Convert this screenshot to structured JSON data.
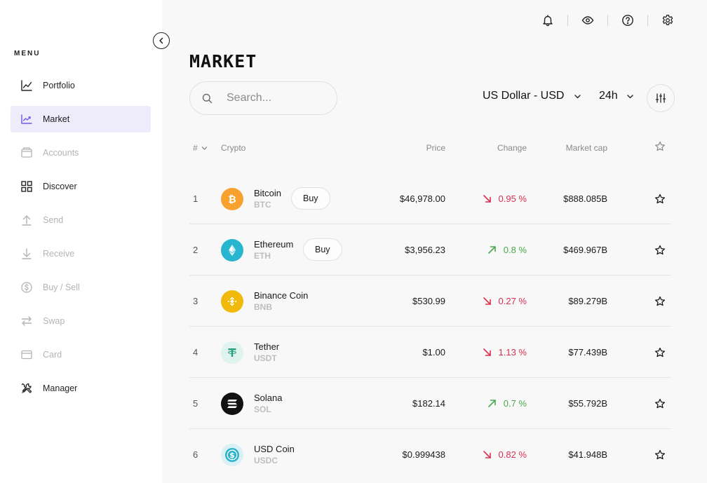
{
  "sidebar": {
    "menu_title": "MENU",
    "items": [
      {
        "label": "Portfolio",
        "icon": "chart-line-icon",
        "state": "enabled"
      },
      {
        "label": "Market",
        "icon": "trend-icon",
        "state": "active"
      },
      {
        "label": "Accounts",
        "icon": "wallet-icon",
        "state": "disabled"
      },
      {
        "label": "Discover",
        "icon": "grid-icon",
        "state": "enabled"
      },
      {
        "label": "Send",
        "icon": "arrow-up-icon",
        "state": "disabled"
      },
      {
        "label": "Receive",
        "icon": "arrow-down-icon",
        "state": "disabled"
      },
      {
        "label": "Buy / Sell",
        "icon": "dollar-circle-icon",
        "state": "disabled"
      },
      {
        "label": "Swap",
        "icon": "swap-icon",
        "state": "disabled"
      },
      {
        "label": "Card",
        "icon": "card-icon",
        "state": "disabled"
      },
      {
        "label": "Manager",
        "icon": "tools-icon",
        "state": "enabled"
      }
    ]
  },
  "topbar": {
    "icons": [
      "bell-icon",
      "eye-icon",
      "help-icon",
      "gear-icon"
    ]
  },
  "main": {
    "title": "MARKET",
    "search_placeholder": "Search...",
    "currency": "US Dollar - USD",
    "period": "24h"
  },
  "table": {
    "headers": {
      "rank": "#",
      "crypto": "Crypto",
      "price": "Price",
      "change": "Change",
      "market_cap": "Market cap"
    },
    "rows": [
      {
        "rank": "1",
        "name": "Bitcoin",
        "symbol": "BTC",
        "price": "$46,978.00",
        "change": "0.95 %",
        "direction": "down",
        "market_cap": "$888.085B",
        "buy": "Buy"
      },
      {
        "rank": "2",
        "name": "Ethereum",
        "symbol": "ETH",
        "price": "$3,956.23",
        "change": "0.8 %",
        "direction": "up",
        "market_cap": "$469.967B",
        "buy": "Buy"
      },
      {
        "rank": "3",
        "name": "Binance Coin",
        "symbol": "BNB",
        "price": "$530.99",
        "change": "0.27 %",
        "direction": "down",
        "market_cap": "$89.279B",
        "buy": ""
      },
      {
        "rank": "4",
        "name": "Tether",
        "symbol": "USDT",
        "price": "$1.00",
        "change": "1.13 %",
        "direction": "down",
        "market_cap": "$77.439B",
        "buy": ""
      },
      {
        "rank": "5",
        "name": "Solana",
        "symbol": "SOL",
        "price": "$182.14",
        "change": "0.7 %",
        "direction": "up",
        "market_cap": "$55.792B",
        "buy": ""
      },
      {
        "rank": "6",
        "name": "USD Coin",
        "symbol": "USDC",
        "price": "$0.999438",
        "change": "0.82 %",
        "direction": "down",
        "market_cap": "$41.948B",
        "buy": ""
      }
    ]
  },
  "colors": {
    "accent": "#6c5ce7",
    "active_bg": "#eeecfb",
    "down": "#d9304f",
    "up": "#48a94b",
    "btc": "#f7a12f",
    "eth": "#27b5d0",
    "bnb": "#f0b90b",
    "usdt": "#26a17b",
    "sol": "#111111",
    "usdc": "#2bb3c9"
  }
}
